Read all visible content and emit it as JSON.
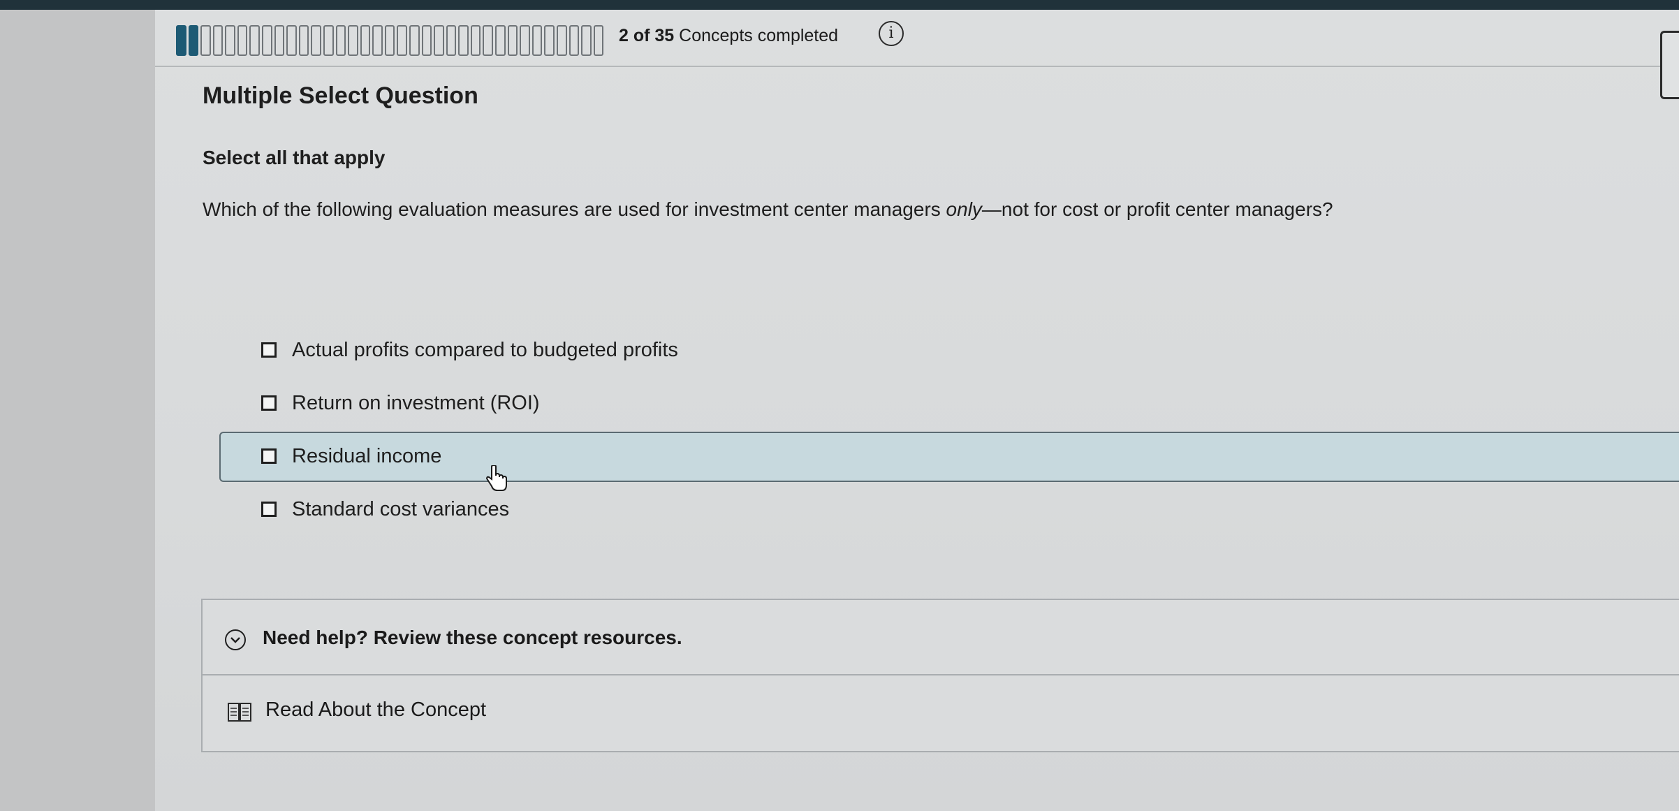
{
  "progress": {
    "completed": 2,
    "total": 35,
    "count_text": "2 of 35",
    "label": "Concepts completed"
  },
  "question": {
    "type_title": "Multiple Select Question",
    "instruction": "Select all that apply",
    "prompt_before": "Which of the following evaluation measures are used for investment center managers ",
    "prompt_emphasis": "only",
    "prompt_after": "—not for cost or profit center managers?"
  },
  "options": [
    {
      "label": "Actual profits compared to budgeted profits",
      "checked": false
    },
    {
      "label": "Return on investment (ROI)",
      "checked": false
    },
    {
      "label": "Residual income",
      "checked": false,
      "hovered": true
    },
    {
      "label": "Standard cost variances",
      "checked": false
    }
  ],
  "help": {
    "toggle_label": "Need help? Review these concept resources.",
    "read_link": "Read About the Concept"
  },
  "icons": {
    "info": "info-icon",
    "toggle": "chevron-down-circle-icon",
    "read": "book-icon",
    "cursor": "hand-cursor-icon"
  },
  "colors": {
    "progress_done": "#1d5a74",
    "highlight_row": "#c7d9de",
    "top_band": "#20323a"
  }
}
